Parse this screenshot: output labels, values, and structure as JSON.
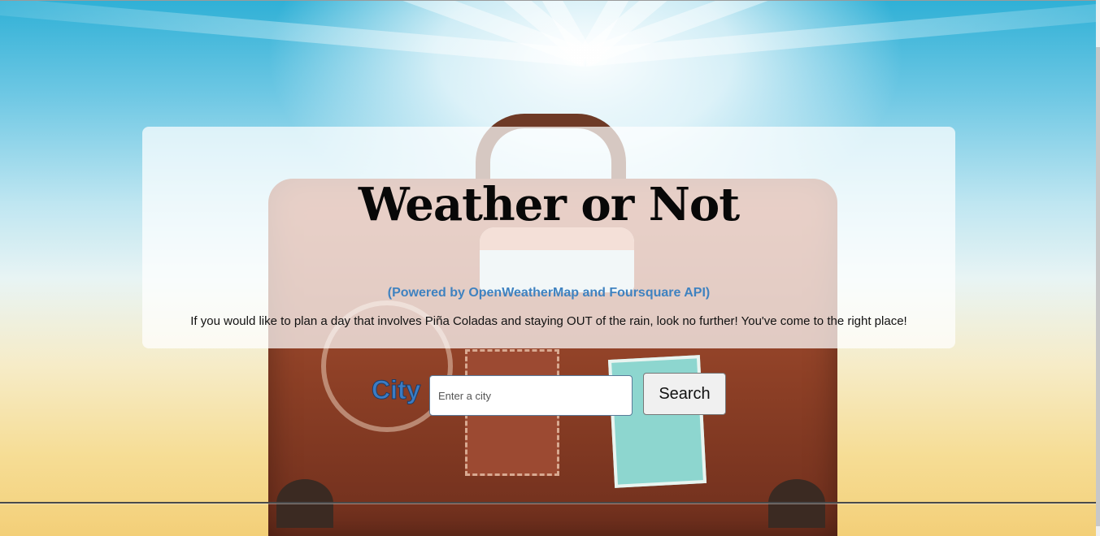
{
  "header": {
    "title": "Weather or Not",
    "powered_by": "(Powered by OpenWeatherMap and Foursquare API)",
    "intro": "If you would like to plan a day that involves Piña Coladas and staying OUT of the rain, look no further! You've come to the right place!"
  },
  "search": {
    "label": "City",
    "placeholder": "Enter a city",
    "value": "",
    "button_label": "Search"
  },
  "colors": {
    "accent": "#3f82c0",
    "city_label": "#3b7cc4"
  }
}
